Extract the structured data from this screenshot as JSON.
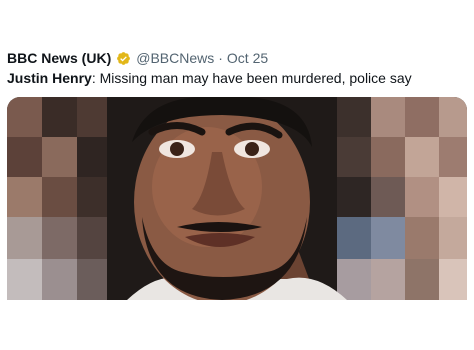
{
  "tweet": {
    "author_name": "BBC News (UK)",
    "handle": "@BBCNews",
    "separator": "·",
    "date": "Oct 25",
    "verified_badge": {
      "icon": "verified-gold-badge-icon",
      "color": "#e2b719"
    },
    "headline_subject": "Justin Henry",
    "headline_text": ": Missing man may have been murdered, police say",
    "image": {
      "description_icon": "portrait-photo-with-pixelated-background"
    }
  }
}
